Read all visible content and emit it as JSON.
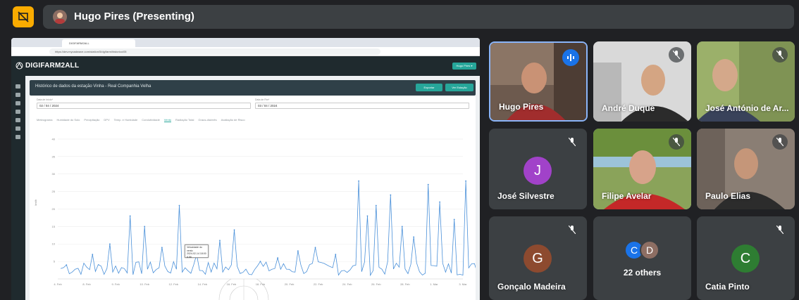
{
  "presenter": {
    "title": "Hugo Pires (Presenting)"
  },
  "shared_screen": {
    "browser_tab": "DIGIFARM2ALL",
    "url": "https://dev.mycadwave.com/station/5/dg/farm/historico/05",
    "app_title": "DIGIFARM2ALL",
    "user_menu": "Hugo Pires ▾",
    "card_title": "Histórico de dados da estação Vinha - Real Companhia Velha",
    "btn_export": "Exportar",
    "btn_station": "Ver Estação",
    "date_start_label": "Data de Início*",
    "date_start": "02 / 04 / 2024",
    "date_end_label": "Data de Fim*",
    "date_end": "03 / 04 / 2024",
    "tabs": [
      "Meteograma",
      "Humidade do Solo",
      "Precipitação",
      "DPV",
      "Temp. e Humidade",
      "Condutividade",
      "Vento",
      "Radiação Total",
      "Graus-dia/mês",
      "Avaliação de Risco"
    ],
    "active_tab": "Vento",
    "chart_data": {
      "type": "line",
      "title": "",
      "xlabel": "",
      "ylabel": "km/h",
      "color": "#4a90d9",
      "x_ticks": [
        "4. Feb",
        "8. Feb",
        "9. Feb",
        "10. Feb",
        "12. Feb",
        "14. Feb",
        "16. Feb",
        "18. Feb",
        "20. Feb",
        "22. Feb",
        "24. Feb",
        "26. Feb",
        "28. Feb",
        "1. Mar",
        "3. Mar"
      ],
      "y_ticks": [
        "5",
        "10",
        "15",
        "20",
        "25",
        "30",
        "35",
        "40"
      ],
      "ylim": [
        0,
        42
      ],
      "peaks": [
        {
          "x": 0.3,
          "y": 4
        },
        {
          "x": 1.2,
          "y": 7
        },
        {
          "x": 1.8,
          "y": 10
        },
        {
          "x": 2.5,
          "y": 18
        },
        {
          "x": 3.0,
          "y": 15
        },
        {
          "x": 3.6,
          "y": 9
        },
        {
          "x": 4.2,
          "y": 21
        },
        {
          "x": 4.8,
          "y": 7
        },
        {
          "x": 5.6,
          "y": 11
        },
        {
          "x": 6.1,
          "y": 14
        },
        {
          "x": 7.0,
          "y": 5
        },
        {
          "x": 7.6,
          "y": 6
        },
        {
          "x": 8.3,
          "y": 8
        },
        {
          "x": 8.9,
          "y": 9
        },
        {
          "x": 9.6,
          "y": 7
        },
        {
          "x": 10.4,
          "y": 28
        },
        {
          "x": 10.7,
          "y": 18
        },
        {
          "x": 11.0,
          "y": 21
        },
        {
          "x": 11.5,
          "y": 24
        },
        {
          "x": 11.9,
          "y": 15
        },
        {
          "x": 12.3,
          "y": 12
        },
        {
          "x": 12.8,
          "y": 27
        },
        {
          "x": 13.2,
          "y": 22
        },
        {
          "x": 13.7,
          "y": 17
        },
        {
          "x": 14.1,
          "y": 28
        },
        {
          "x": 14.7,
          "y": 12
        },
        {
          "x": 15.4,
          "y": 33
        },
        {
          "x": 15.9,
          "y": 19
        },
        {
          "x": 16.4,
          "y": 11
        },
        {
          "x": 17.0,
          "y": 17
        }
      ],
      "tooltip": {
        "title": "Velocidade do vento",
        "date": "2024-02-14 18:00",
        "value": "6.56"
      }
    }
  },
  "participants": [
    {
      "name": "Hugo Pires",
      "state": "speaking"
    },
    {
      "name": "André Duque",
      "state": "muted"
    },
    {
      "name": "José António de Ar...",
      "state": "muted"
    },
    {
      "name": "José Silvestre",
      "initial": "J",
      "avatar_color": "#a142c9",
      "state": "muted"
    },
    {
      "name": "Filipe Avelar",
      "state": "muted"
    },
    {
      "name": "Paulo Elias",
      "state": "muted"
    },
    {
      "name": "Gonçalo Madeira",
      "initial": "G",
      "avatar_color": "#8d4a2f",
      "state": "muted"
    },
    {
      "name": "22 others",
      "initials": [
        "C",
        "D"
      ],
      "avatar_colors": [
        "#1a73e8",
        "#8d6e63"
      ]
    },
    {
      "name": "Catia Pinto",
      "initial": "C",
      "avatar_color": "#2e7d32",
      "state": "muted"
    }
  ]
}
